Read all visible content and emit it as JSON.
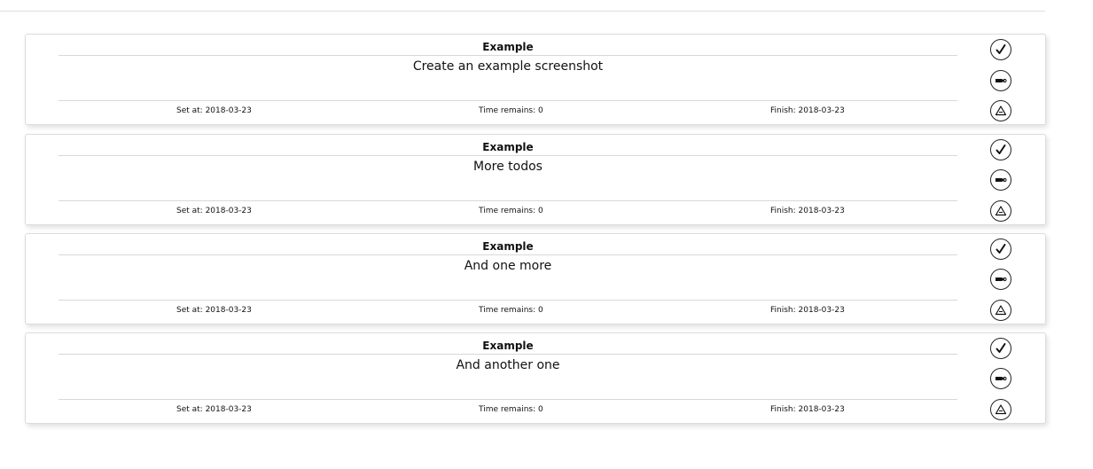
{
  "todos": [
    {
      "title": "Example",
      "text": "Create an example screenshot",
      "set_at": "Set at: 2018-03-23",
      "time_remains": "Time remains: 0",
      "finish": "Finish: 2018-03-23",
      "actions": [
        "check-icon",
        "edit-icon",
        "delete-icon"
      ]
    },
    {
      "title": "Example",
      "text": "More todos",
      "set_at": "Set at: 2018-03-23",
      "time_remains": "Time remains: 0",
      "finish": "Finish: 2018-03-23",
      "actions": [
        "check-icon",
        "edit-icon",
        "delete-icon"
      ]
    },
    {
      "title": "Example",
      "text": "And one more",
      "set_at": "Set at: 2018-03-23",
      "time_remains": "Time remains: 0",
      "finish": "Finish: 2018-03-23",
      "actions": [
        "check-icon",
        "edit-icon",
        "delete-icon"
      ]
    },
    {
      "title": "Example",
      "text": "And another one",
      "set_at": "Set at: 2018-03-23",
      "time_remains": "Time remains: 0",
      "finish": "Finish: 2018-03-23",
      "actions": [
        "check-icon",
        "edit-icon",
        "delete-icon"
      ]
    }
  ],
  "colors": {
    "card_border": "#dcdcdc",
    "divider": "#d8d8d8",
    "icon_stroke": "#222222"
  }
}
